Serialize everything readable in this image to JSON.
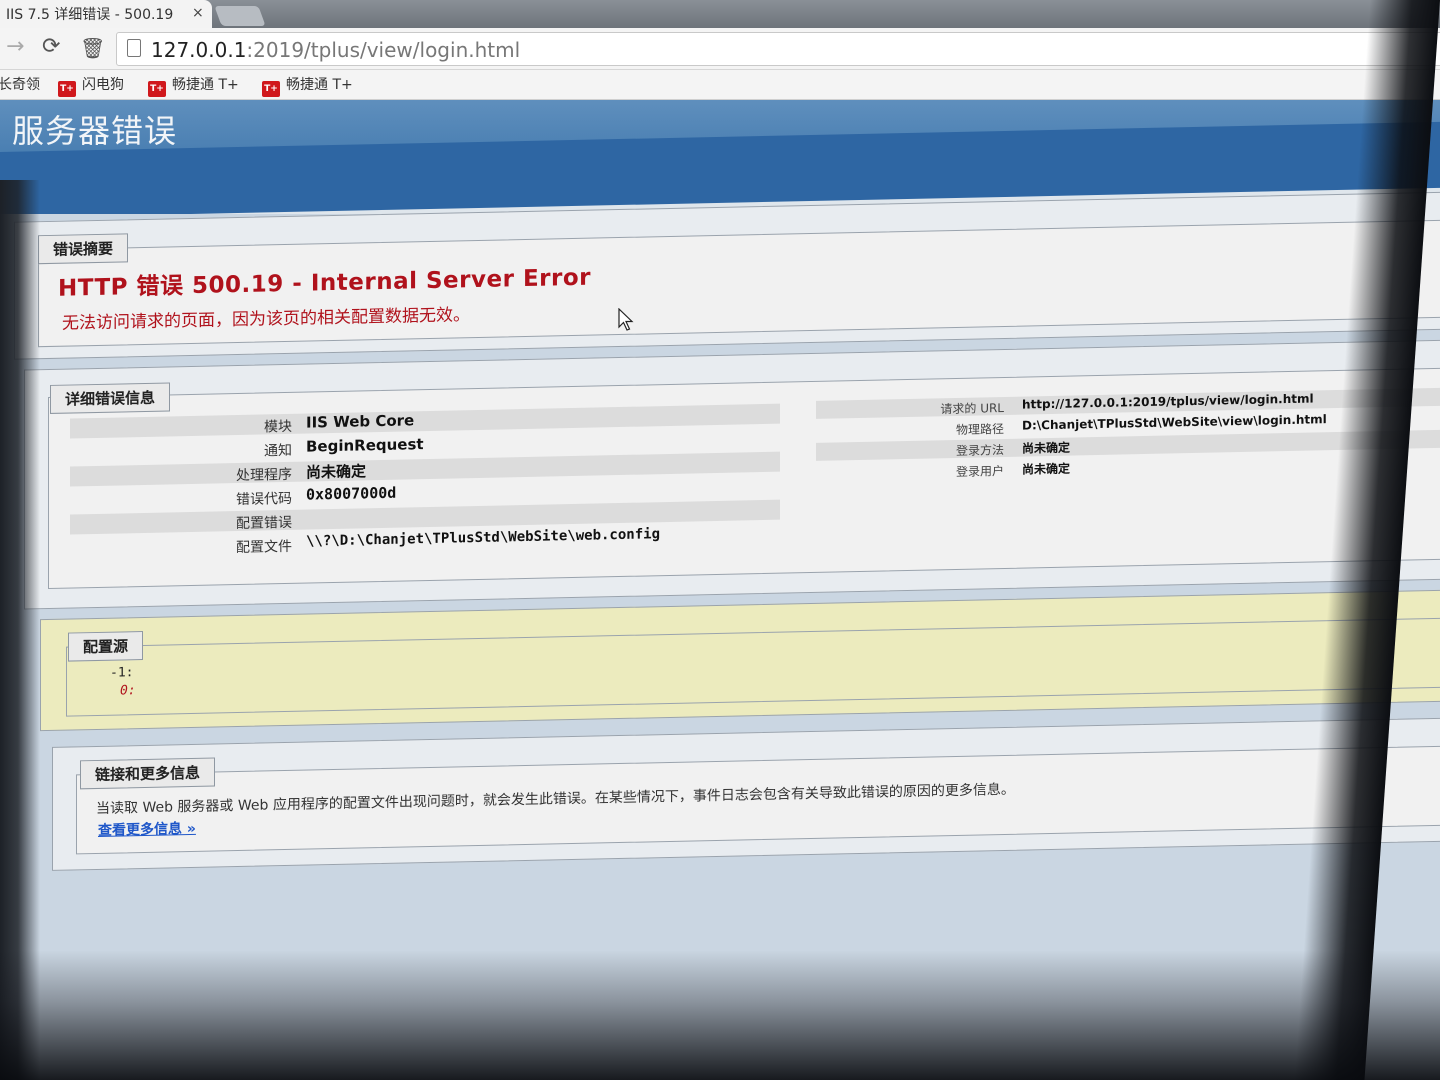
{
  "browser": {
    "tab_title": "IIS 7.5 详细错误 - 500.19",
    "tab_close": "×",
    "url_host": "127.0.0.1",
    "url_rest": ":2019/tplus/view/login.html",
    "bookmarks": [
      {
        "label": "长奇领"
      },
      {
        "label": "闪电狗",
        "icon": "T+"
      },
      {
        "label": "畅捷通 T+",
        "icon": "T+"
      },
      {
        "label": "畅捷通 T+",
        "icon": "T+"
      }
    ]
  },
  "header": {
    "title": "服务器错误"
  },
  "summary": {
    "legend": "错误摘要",
    "error_title": "HTTP 错误 500.19 - Internal Server Error",
    "error_desc": "无法访问请求的页面，因为该页的相关配置数据无效。"
  },
  "details": {
    "legend": "详细错误信息",
    "left": [
      {
        "label": "模块",
        "value": "IIS Web Core"
      },
      {
        "label": "通知",
        "value": "BeginRequest"
      },
      {
        "label": "处理程序",
        "value": "尚未确定"
      },
      {
        "label": "错误代码",
        "value": "0x8007000d"
      },
      {
        "label": "配置错误",
        "value": ""
      },
      {
        "label": "配置文件",
        "value": "\\\\?\\D:\\Chanjet\\TPlusStd\\WebSite\\web.config"
      }
    ],
    "right": [
      {
        "label": "请求的 URL",
        "value": "http://127.0.0.1:2019/tplus/view/login.html"
      },
      {
        "label": "物理路径",
        "value": "D:\\Chanjet\\TPlusStd\\WebSite\\view\\login.html"
      },
      {
        "label": "登录方法",
        "value": "尚未确定"
      },
      {
        "label": "登录用户",
        "value": "尚未确定"
      }
    ]
  },
  "config_source": {
    "legend": "配置源",
    "lines": [
      "-1:",
      "0:"
    ]
  },
  "links": {
    "legend": "链接和更多信息",
    "text": "当读取 Web 服务器或 Web 应用程序的配置文件出现问题时，就会发生此错误。在某些情况下，事件日志会包含有关导致此错误的原因的更多信息。",
    "more_link": "查看更多信息 »"
  },
  "colors": {
    "error_red": "#b0121c",
    "header_blue": "#4a7fb2",
    "link_blue": "#1f57c9",
    "config_yellow": "#ecebbe"
  }
}
